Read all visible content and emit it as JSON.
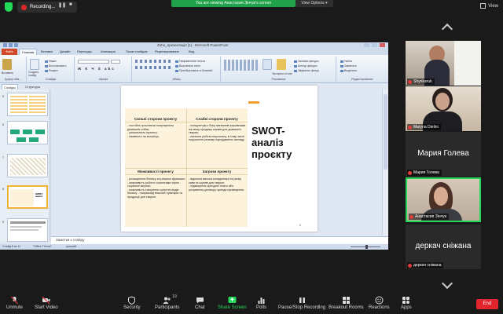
{
  "zoom_top": {
    "recording_label": "Recording...",
    "banner": "You are viewing Анастасия Зінчук's screen",
    "view_options": "View Options",
    "view_label": "View"
  },
  "ppt": {
    "window_title": "Zoho_презентація [1] - Microsoft PowerPoint",
    "file_tab": "Файл",
    "tabs": [
      "Главная",
      "Вставка",
      "Дизайн",
      "Переходы",
      "Анимация",
      "Показ слайдов",
      "Рецензирование",
      "Вид"
    ],
    "ribbon": {
      "paste": "Вставить",
      "create_slide": "Создать слайд",
      "clipboard_label": "Буфер обм...",
      "slides_items": [
        "Макет",
        "Восстановить",
        "Раздел"
      ],
      "slides_label": "Слайды",
      "font_label": "Шрифт",
      "paragraph_label": "Абзац",
      "paragraph_items": [
        "Направление текста",
        "Выровнять текст",
        "Преобразовать в SmartArt"
      ],
      "drawing_label": "Рисование",
      "quick_styles": "Экспресс-стили",
      "drawing_items": [
        "Заливка фигуры",
        "Контур фигуры",
        "Эффекты фигур"
      ],
      "edit_items": [
        "Найти",
        "Заменить",
        "Выделить"
      ],
      "edit_label": "Редактирование"
    },
    "panel_tabs": [
      "Слайды",
      "Структура"
    ],
    "thumb_numbers": [
      "5",
      "6",
      "7",
      "8",
      "9"
    ],
    "slide": {
      "swot_title": "SWOT-аналіз проєкту",
      "page_number": "8",
      "strengths_head": "Сильні сторони проекту",
      "strengths_body": "- постійно зростаюча популярність домашніх собак;\n- унікальність проекту;\n- наявність на кількісць;",
      "weaknesses_head": "Слабкі сторони проекту",
      "weaknesses_body": "- конкуренція з боку магазинів-кормівників на місць продажу кормів для домашніх тварин;\n- нинішня робота персоналу, в тому числі порушення режиму підгодування закладу",
      "opportunities_head": "Можливості проекту",
      "opportunities_body": "- розширення бізнесу за рахунок франшиз;\n- можливість роботи з клієнтами через соціальні мережі;\n- можливість створення супутніх видів бізнесу - наприклад власних сувенірів та продукції для тварин.",
      "threats_head": "Загрози проекту",
      "threats_body": "- відносно висока конкуренція на ринку кави та кормів для тварин;\n- підвищення орендної плати або розірвання договору оренди приміщення."
    },
    "notes": "Заметки к слайду",
    "status": [
      "Слайд 8 из 11",
      "\"Office Theme\"",
      "русский"
    ]
  },
  "participants": [
    {
      "name": "Shynkaruk",
      "has_video": true
    },
    {
      "name": "Maryna Dielini",
      "has_video": true
    },
    {
      "name": "Мария Голева",
      "has_video": false
    },
    {
      "name": "Анастасия Зінчук",
      "has_video": true,
      "active": true
    },
    {
      "name": "деркач сніжана",
      "has_video": false
    }
  ],
  "toolbar": {
    "unmute": "Unmute",
    "start_video": "Start Video",
    "security": "Security",
    "participants": "Participants",
    "participants_count": "19",
    "chat": "Chat",
    "share_screen": "Share Screen",
    "polls": "Polls",
    "recording": "Pause/Stop Recording",
    "breakout": "Breakout Rooms",
    "reactions": "Reactions",
    "apps": "Apps",
    "end": "End"
  },
  "colors": {
    "zoom_green": "#23d959",
    "end_red": "#e0262c",
    "ppt_file_tab": "#d24726",
    "swot_fill": "#fdf3dd",
    "accent_orange": "#f0a030"
  }
}
